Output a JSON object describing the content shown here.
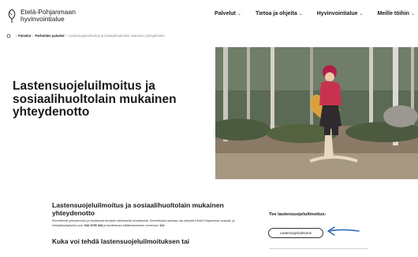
{
  "header": {
    "logo_line1": "Etelä-Pohjanmaan",
    "logo_line2": "hyvinvointialue",
    "nav": [
      {
        "label": "Palvelut"
      },
      {
        "label": "Tietoa ja ohjeita"
      },
      {
        "label": "Hyvinvointialue"
      },
      {
        "label": "Meille töihin"
      }
    ]
  },
  "breadcrumb": {
    "items": [
      "Palvelut",
      "Perheiden palvelut"
    ],
    "current": "Lastensuojeluilmoitus ja sosiaalihuoltolain mukainen yhteydenotto"
  },
  "hero": {
    "title": "Lastensuojeluilmoitus ja sosiaalihuoltolain mukainen yhteydenotto"
  },
  "content": {
    "title": "Lastensuojeluilmoitus ja sosiaalihuoltolain mukainen yhteydenotto",
    "text_1": "Kiireettömät yhteydenotot ja ilmoitukset tehdään sähköisellä lomakkeella. Kiireellisissä asioissa ota",
    "text_2": "yhteyttä Etelä-Pohjanmaan sosiaali- ja kriisipäivystykseen puh.",
    "phone": "044 4700 444",
    "text_3": "ja tarvittaessa",
    "text_4": "hätäkeskukseen numeroon",
    "emergency": "112",
    "subtitle": "Kuka voi tehdä lastensuojeluilmoituksen tai"
  },
  "side": {
    "title": "Tee lastensuojeluilmoitus:",
    "button_label": "Lastensuojeluilmoitus"
  },
  "colors": {
    "accent_arrow": "#2f6bb5",
    "text": "#1a1a1a"
  }
}
